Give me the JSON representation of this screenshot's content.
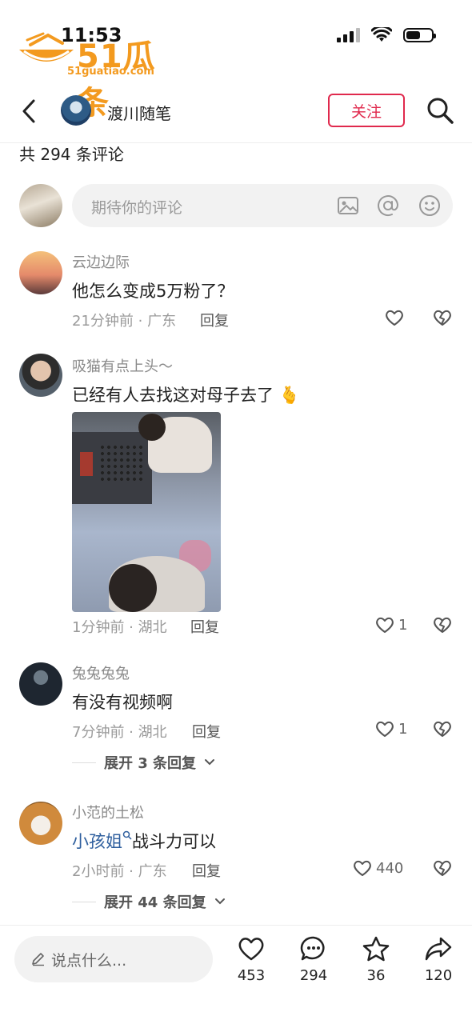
{
  "status": {
    "time": "11:53"
  },
  "watermark": {
    "title": "51瓜条",
    "url": "51guatiao.com"
  },
  "header": {
    "author_name": "渡川随笔",
    "follow_label": "关注"
  },
  "comment_count": "共 294 条评论",
  "input": {
    "placeholder": "期待你的评论"
  },
  "comments": [
    {
      "user": "云边边际",
      "text": "他怎么变成5万粉了？",
      "time": "21分钟前 · 广东",
      "reply": "回复",
      "likes": ""
    },
    {
      "user": "吸猫有点上头～",
      "text": "已经有人去找这对母子去了",
      "emoji": "🫰",
      "time": "1分钟前 · 湖北",
      "reply": "回复",
      "likes": "1"
    },
    {
      "user": "兔兔兔兔",
      "text": "有没有视频啊",
      "time": "7分钟前 · 湖北",
      "reply": "回复",
      "likes": "1",
      "expand": "展开 3 条回复"
    },
    {
      "user": "小范的土松",
      "mention": "小孩姐",
      "text": "战斗力可以",
      "time": "2小时前 · 广东",
      "reply": "回复",
      "likes": "440",
      "expand": "展开 44 条回复"
    }
  ],
  "bottom": {
    "placeholder": "说点什么...",
    "likes": "453",
    "comments": "294",
    "favorites": "36",
    "shares": "120"
  }
}
